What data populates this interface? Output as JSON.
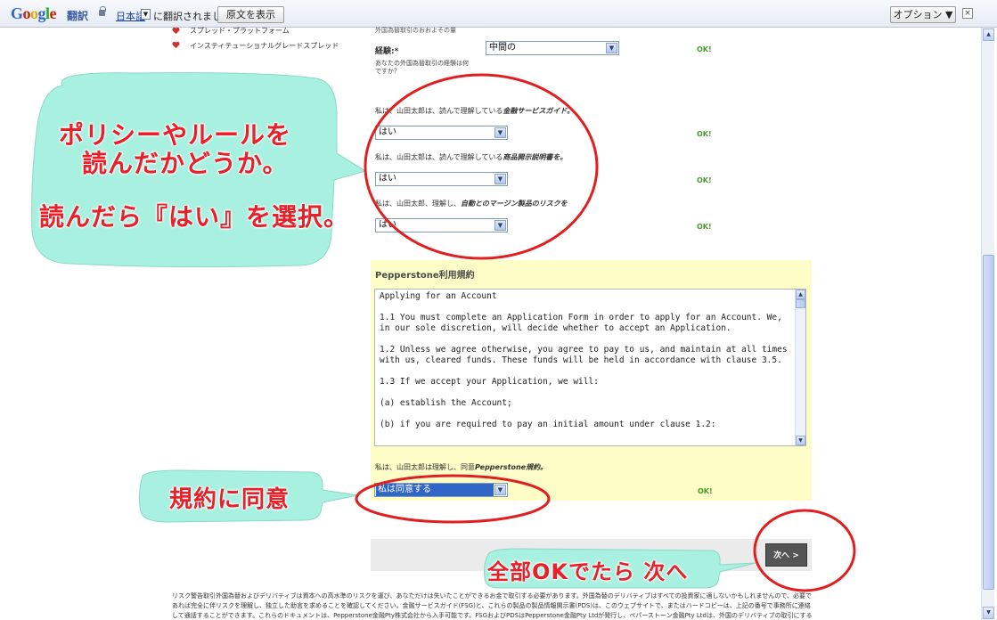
{
  "translate_bar": {
    "logo_letters": [
      "G",
      "o",
      "o",
      "g",
      "l",
      "e"
    ],
    "logo_colors": [
      "#3366cc",
      "#cc2200",
      "#e8a600",
      "#3366cc",
      "#22aa22",
      "#cc2200"
    ],
    "product": "翻訳",
    "language": "日本語",
    "language_arrow": "▼",
    "message": "に翻訳されました",
    "show_original": "原文を表示",
    "options": "オプション ▼",
    "close": "×"
  },
  "sidebar": {
    "items": [
      {
        "label": "スプレッド・プラットフォーム"
      },
      {
        "label": "インスティテューショナルグレードスプレッド"
      }
    ]
  },
  "form": {
    "top_text": "外国為替取引のおおよその量",
    "occupation": {
      "label": "経験:*",
      "help": "あなたの外国為替取引の経験は何ですか？",
      "value": "中間の",
      "status": "OK!"
    },
    "questions": [
      {
        "prefix": "私は、山田太郎は、読んで理解している",
        "emph": "金融サービスガイド。",
        "value": "はい",
        "status": "OK!"
      },
      {
        "prefix": "私は、山田太郎は、読んで理解している",
        "emph": "商品開示説明書を。",
        "value": "はい",
        "status": "OK!"
      },
      {
        "prefix": "私は、山田太郎、理解し、",
        "emph": "自動とのマージン製品のリスクを",
        "value": "はい",
        "status": "OK!"
      }
    ]
  },
  "terms": {
    "title": "Pepperstone利用規約",
    "text": "Applying for an Account\n\n1.1 You must complete an Application Form in order to apply for an Account. We, in our sole discretion, will decide whether to accept an Application.\n\n1.2 Unless we agree otherwise, you agree to pay to us, and maintain at all times with us, cleared funds. These funds will be held in accordance with clause 3.5.\n\n1.3 If we accept your Application, we will:\n\n(a) establish the Account;\n\n(b) if you are required to pay an initial amount under clause 1.2:",
    "agree_text_prefix": "私は、山田太郎は理解し、同意",
    "agree_text_emph": "Pepperstone規約。",
    "agree_value": "私は同意する",
    "status": "OK!"
  },
  "next_button": "次へ >",
  "disclaimer": "リスク警告取引外国為替およびデリバティブは資本への高水準のリスクを運び、あなただけは失いたことができるお金で取引する必要があります。外国為替のデリバティブはすべての投資家に適しないかもしれませんので、必要であれば完全に伴リスクを理解し、独立した助言を求めることを確認してください。金融サービスガイド(FSG)と、これらの製品の製品情報開示書(PDS)は、このウェブサイトで、またはハードコピーは、上記の番号で事務所に連絡して通話することができます。これらのドキュメントは、Pepperstone金融Pty株式会社から入手可能です。FSGおよびPDSはPepperstone金融Pty Ltdが発行し、ペパーストーン金融Pty Ltdは、外国のデリバティブの取引にすることを決める前に、ASICが発行したライセンスを保有しています。",
  "annotations": {
    "policy_line1": "ポリシーやルールを",
    "policy_line2": "読んだかどうか。",
    "policy_line3": "読んだら『はい』を選択。",
    "agree": "規約に同意",
    "next": "全部OKでたら 次へ"
  },
  "colors": {
    "annotation_bubble": "#a8f0e0",
    "annotation_text": "#e8202a",
    "annotation_ring": "#e02020",
    "terms_background": "#fdfdc8"
  }
}
